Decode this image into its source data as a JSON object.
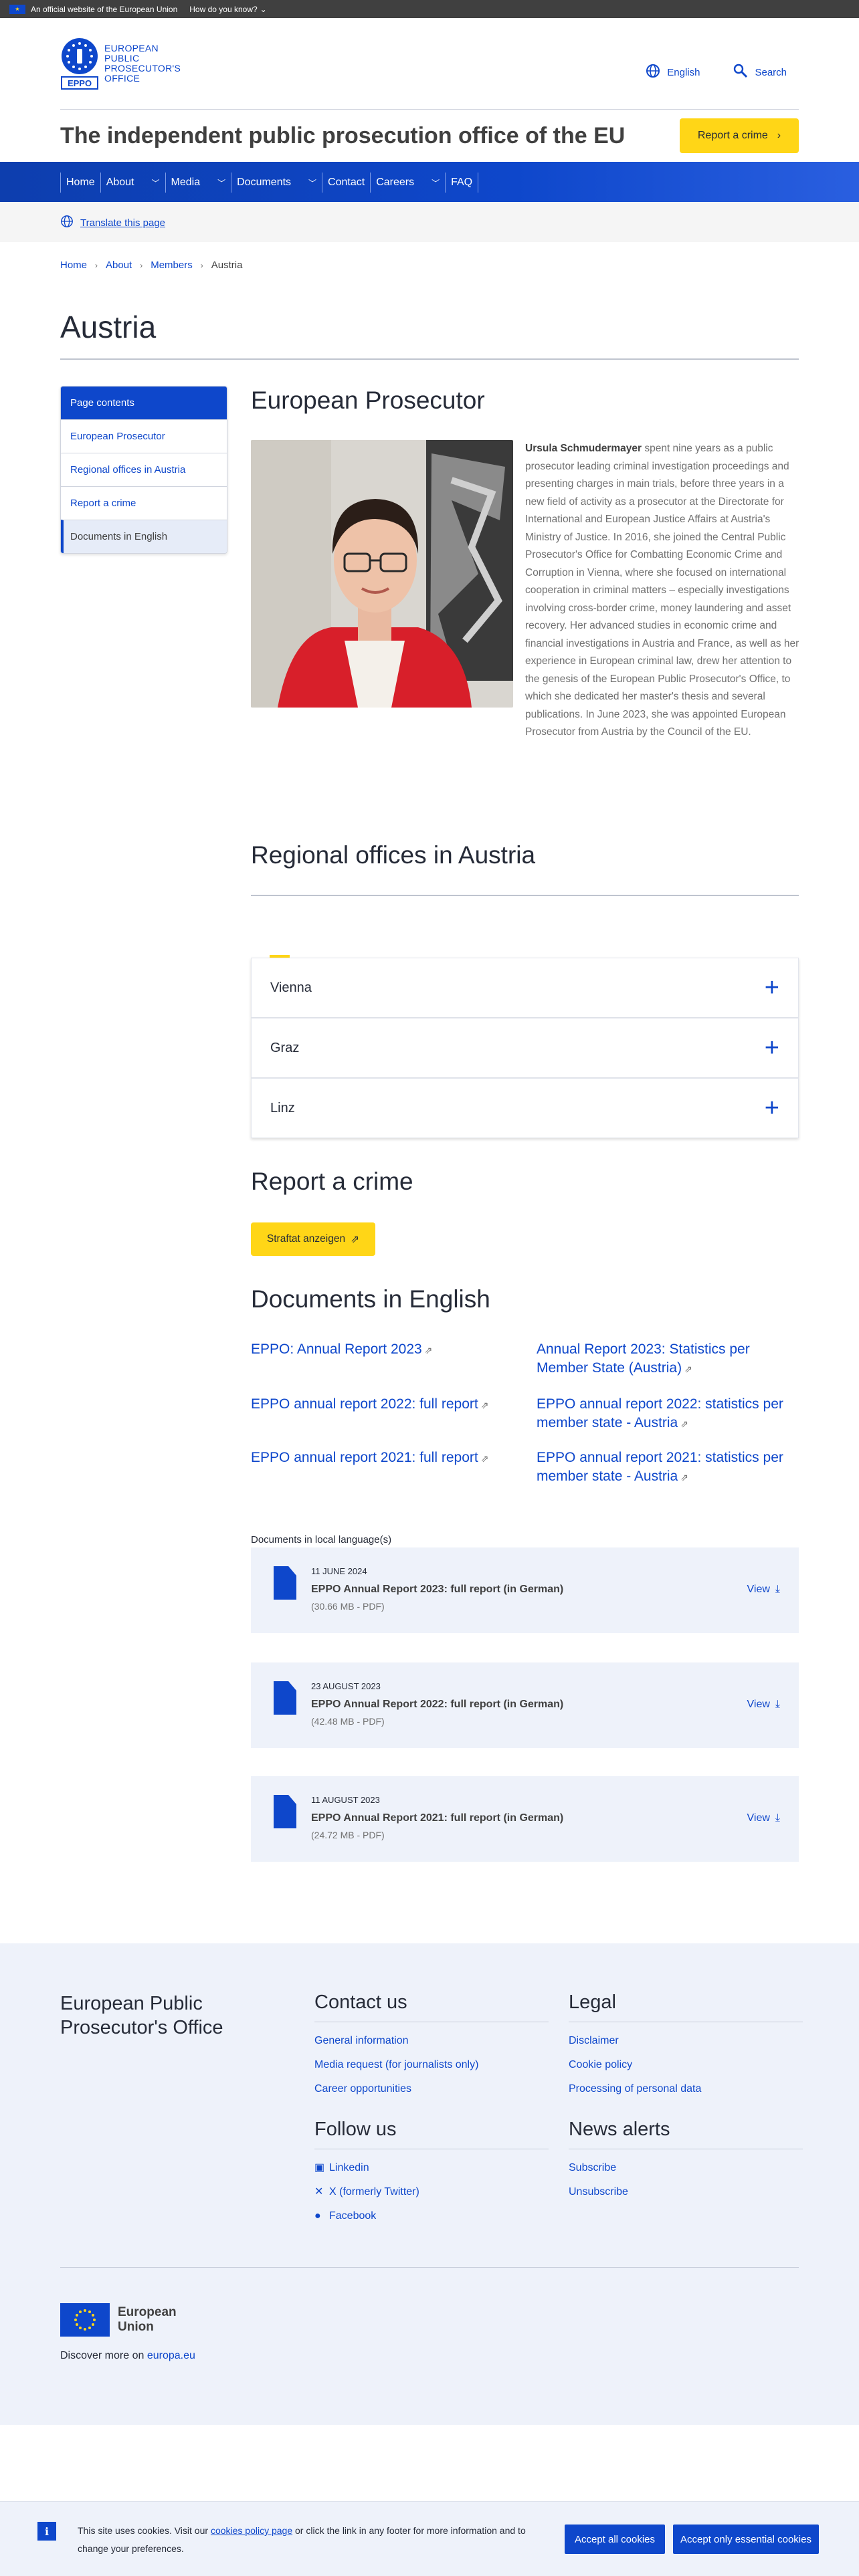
{
  "eu_banner": {
    "official": "An official website of the European Union",
    "how": "How do you know?"
  },
  "header": {
    "logo_line1": "EUROPEAN",
    "logo_line2": "PUBLIC",
    "logo_line3": "PROSECUTOR'S",
    "logo_line4": "OFFICE",
    "logo_mark": "EPPO",
    "language": "English",
    "search": "Search",
    "site_title": "The independent public prosecution office of the EU",
    "report_button": "Report a crime"
  },
  "nav": {
    "items": [
      "Home",
      "About",
      "Media",
      "Documents",
      "Contact",
      "Careers",
      "FAQ"
    ]
  },
  "translate": "Translate this page",
  "breadcrumb": [
    "Home",
    "About",
    "Members",
    "Austria"
  ],
  "page_title": "Austria",
  "sidebar": {
    "heading": "Page contents",
    "items": [
      "European Prosecutor",
      "Regional offices in Austria",
      "Report a crime",
      "Documents in English"
    ]
  },
  "prosecutor": {
    "heading": "European Prosecutor",
    "name": "Ursula Schmudermayer",
    "bio": " spent nine years as a public prosecutor leading criminal investigation proceedings and presenting charges in main trials, before three years in a new field of activity as a prosecutor at the Directorate for International and European Justice Affairs at Austria's Ministry of Justice. In 2016, she joined the Central Public Prosecutor's Office for Combatting Economic Crime and Corruption in Vienna, where she focused on international cooperation in criminal matters – especially investigations involving cross-border crime, money laundering and asset recovery. Her advanced studies in economic crime and financial investigations in Austria and France, as well as her experience in European criminal law, drew her attention to the genesis of the European Public Prosecutor's Office, to which she dedicated her master's thesis and several publications. In June 2023, she was appointed European Prosecutor from Austria by the Council of the EU."
  },
  "regional": {
    "heading": "Regional offices in Austria",
    "offices": [
      "Vienna",
      "Graz",
      "Linz"
    ]
  },
  "report": {
    "heading": "Report a crime",
    "button": "Straftat anzeigen"
  },
  "documents": {
    "heading": "Documents in English",
    "links": [
      "EPPO: Annual Report 2023",
      "Annual Report 2023: Statistics per Member State (Austria)",
      "EPPO annual report 2022: full report",
      "EPPO annual report 2022: statistics per member state - Austria",
      "EPPO annual report 2021: full report",
      "EPPO annual report 2021: statistics per member state - Austria"
    ],
    "local_label": "Documents in local language(s)",
    "files": [
      {
        "date": "11 JUNE 2024",
        "title": "EPPO Annual Report 2023: full report (in German)",
        "meta": "(30.66 MB - PDF)",
        "action": "View"
      },
      {
        "date": "23 AUGUST 2023",
        "title": "EPPO Annual Report 2022: full report (in German)",
        "meta": "(42.48 MB - PDF)",
        "action": "View"
      },
      {
        "date": "11 AUGUST 2023",
        "title": "EPPO Annual Report 2021: full report (in German)",
        "meta": "(24.72 MB - PDF)",
        "action": "View"
      }
    ]
  },
  "footer": {
    "org": "European Public Prosecutor's Office",
    "contact_heading": "Contact us",
    "contact_links": [
      "General information",
      "Media request (for journalists only)",
      "Career opportunities"
    ],
    "follow_heading": "Follow us",
    "follow_links": [
      "Linkedin",
      "X (formerly Twitter)",
      "Facebook"
    ],
    "legal_heading": "Legal",
    "legal_links": [
      "Disclaimer",
      "Cookie policy",
      "Processing of personal data"
    ],
    "news_heading": "News alerts",
    "news_links": [
      "Subscribe",
      "Unsubscribe"
    ],
    "eu_line1": "European",
    "eu_line2": "Union",
    "discover_prefix": "Discover more on ",
    "discover_link": "europa.eu"
  },
  "cookie": {
    "text_before": "This site uses cookies. Visit our ",
    "link": "cookies policy page",
    "text_after": " or click the link in any footer for more information and to change your preferences.",
    "accept_all": "Accept all cookies",
    "accept_essential": "Accept only essential cookies"
  },
  "colors": {
    "primary": "#0e47cb",
    "accent": "#ffd617",
    "dark": "#262b38"
  }
}
